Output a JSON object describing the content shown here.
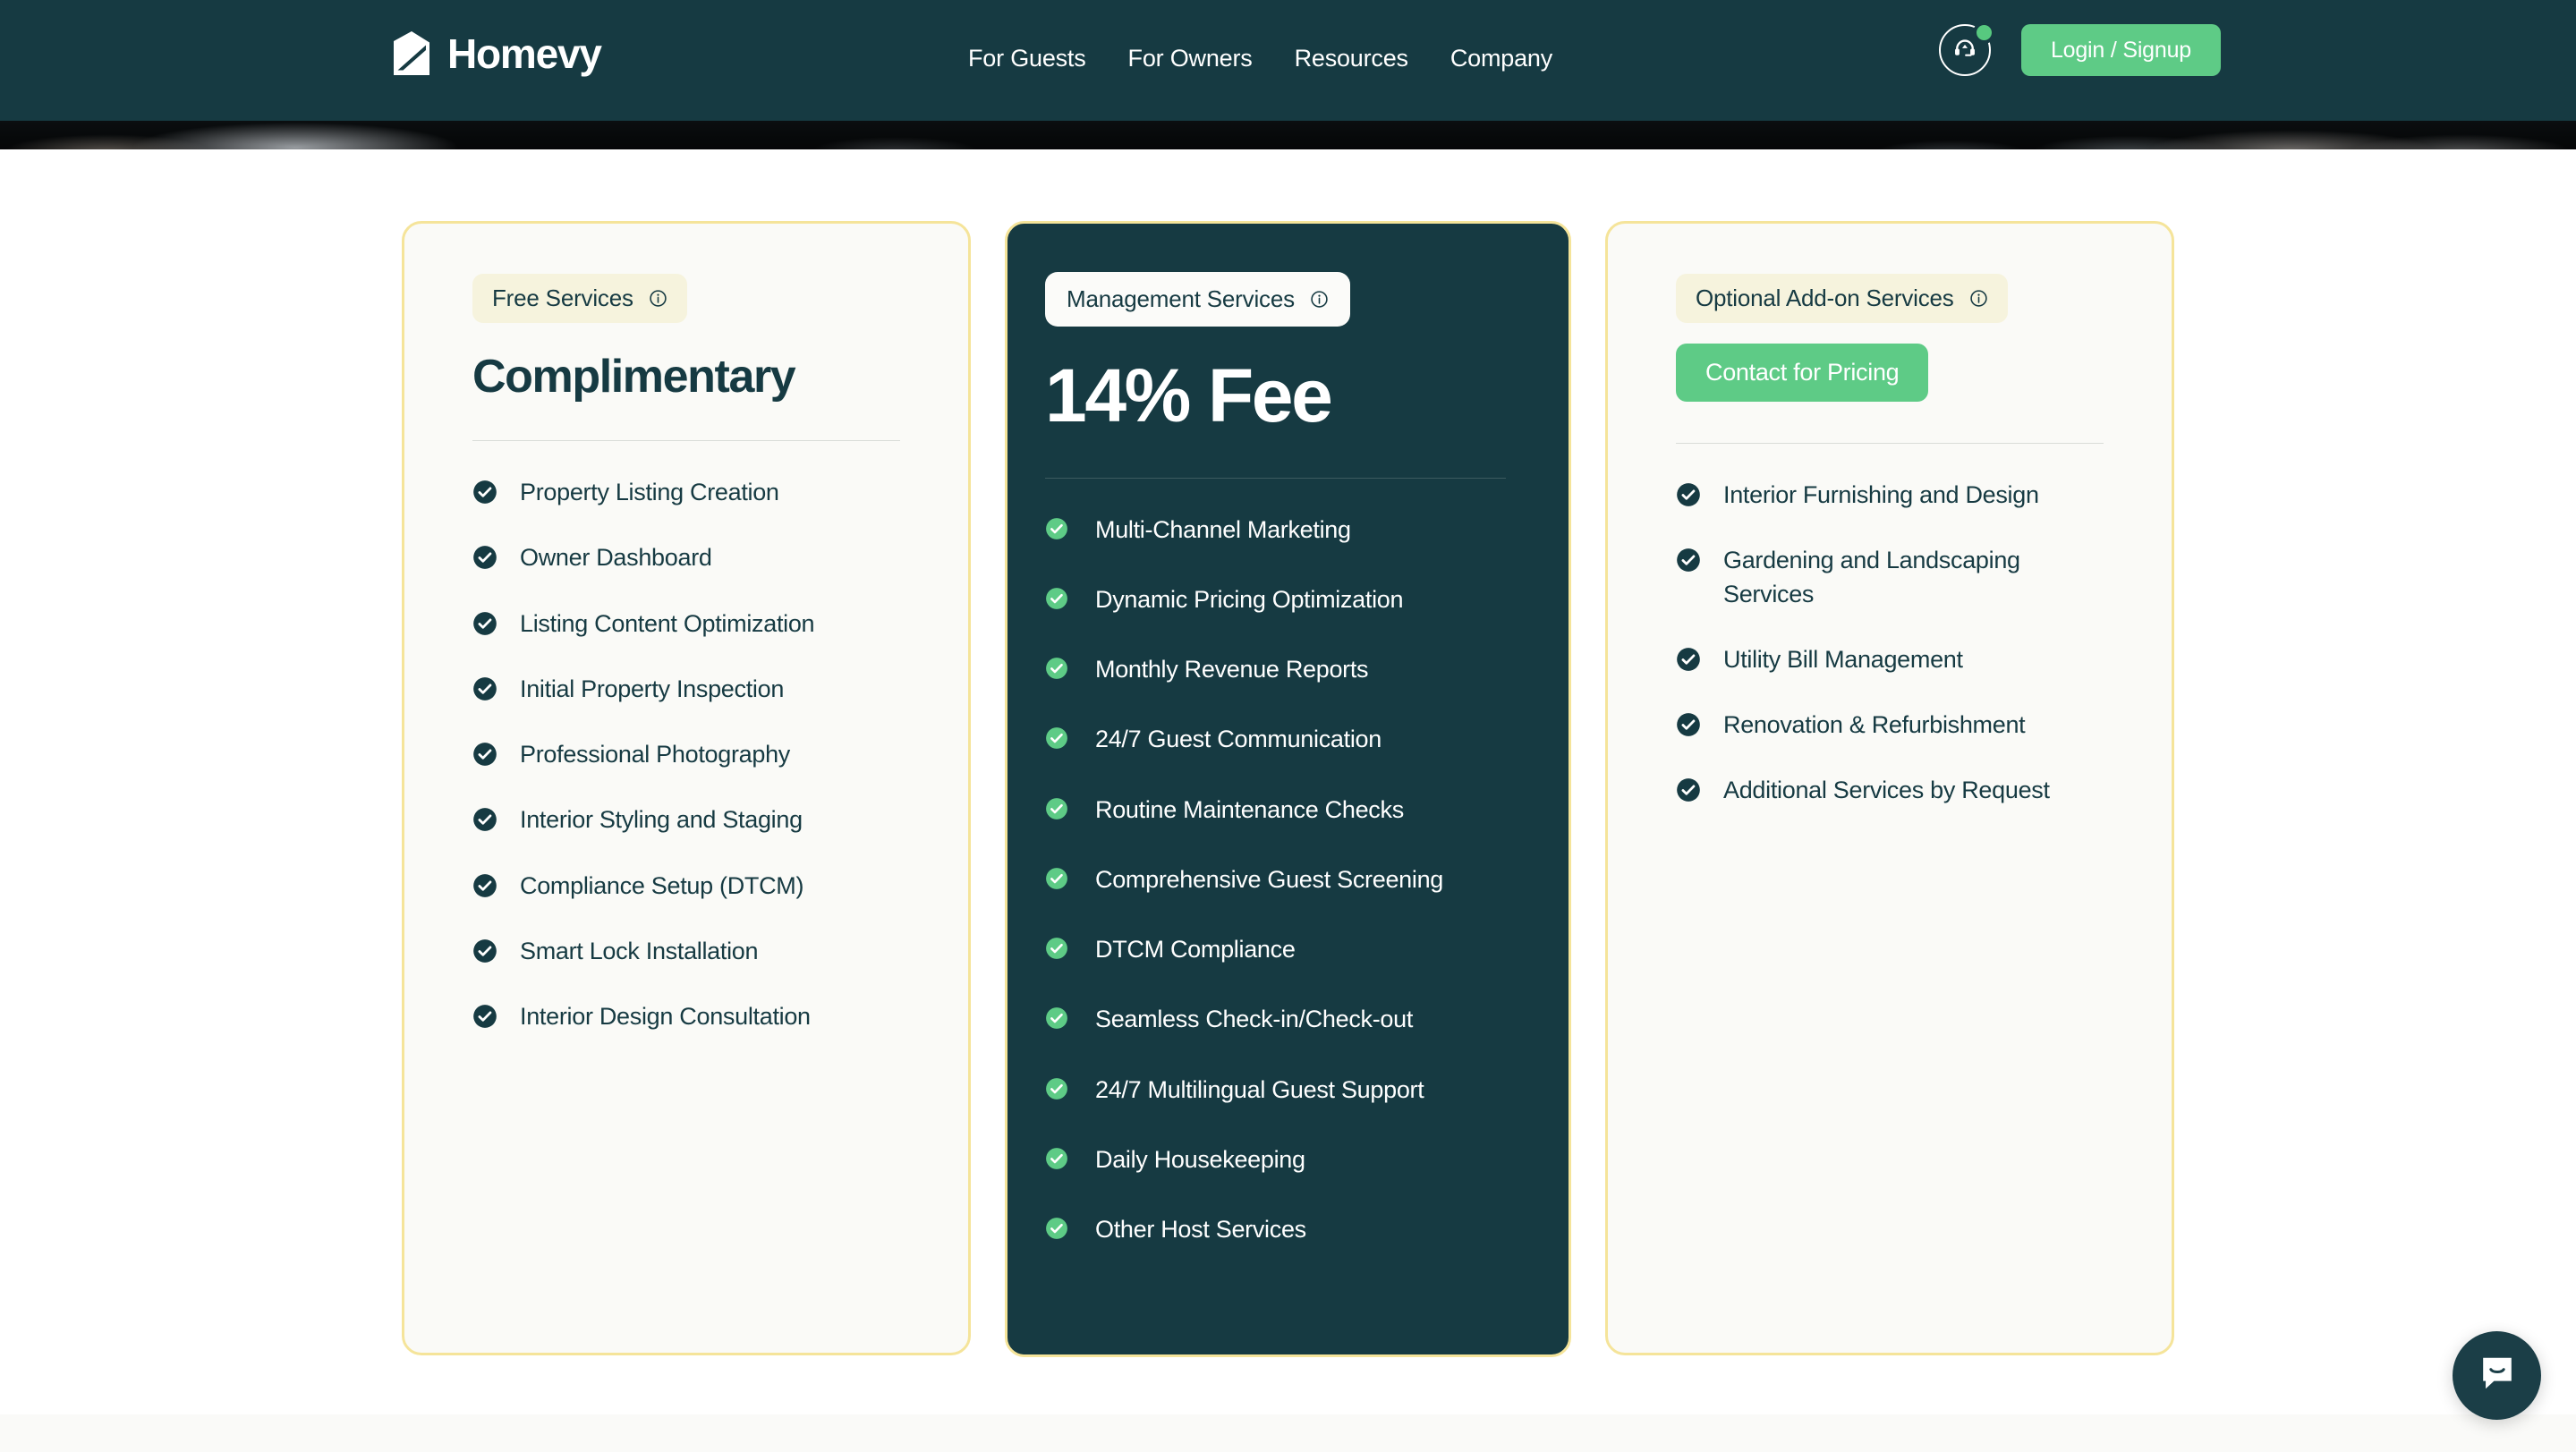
{
  "header": {
    "brand_name": "Homevy",
    "logo_icon": "house-logo-icon",
    "nav": [
      {
        "label": "For Guests"
      },
      {
        "label": "For Owners"
      },
      {
        "label": "Resources"
      },
      {
        "label": "Company"
      }
    ],
    "support_icon": "headset-support-icon",
    "support_status_dot": "online-status-dot",
    "login_label": "Login / Signup",
    "colors": {
      "header_bg": "#163a42",
      "accent_green": "#5ecb86",
      "status_dot": "#57c97f"
    }
  },
  "pricing": {
    "cards": [
      {
        "id": "free-services",
        "tag_label": "Free Services",
        "tag_info_icon": "info-circle-icon",
        "headline": "Complimentary",
        "cta_label": null,
        "features": [
          "Property Listing Creation",
          "Owner Dashboard",
          "Listing Content Optimization",
          "Initial Property Inspection",
          "Professional Photography",
          "Interior Styling and Staging",
          "Compliance Setup (DTCM)",
          "Smart Lock Installation",
          "Interior Design Consultation"
        ]
      },
      {
        "id": "management-services",
        "tag_label": "Management Services",
        "tag_info_icon": "info-circle-icon",
        "headline": "14% Fee",
        "cta_label": null,
        "features": [
          "Multi-Channel Marketing",
          "Dynamic Pricing Optimization",
          "Monthly Revenue Reports",
          "24/7 Guest Communication",
          "Routine Maintenance Checks",
          "Comprehensive Guest Screening",
          "DTCM Compliance",
          "Seamless Check-in/Check-out",
          "24/7 Multilingual Guest Support",
          "Daily Housekeeping",
          "Other Host Services"
        ]
      },
      {
        "id": "optional-addons",
        "tag_label": "Optional Add-on Services",
        "tag_info_icon": "info-circle-icon",
        "headline": null,
        "cta_label": "Contact for Pricing",
        "features": [
          "Interior Furnishing and Design",
          "Gardening and Landscaping Services",
          "Utility Bill Management",
          "Renovation & Refurbishment",
          "Additional Services by Request"
        ]
      }
    ],
    "colors": {
      "card_border": "#f5e49a",
      "card_light_bg": "#fafaf7",
      "card_dark_bg": "#163a42",
      "tag_cream_bg": "#f6f3dd",
      "tag_white_bg": "#fbfbf9",
      "check_dark": "#163a42",
      "check_green": "#5ecb86"
    }
  },
  "chat_widget": {
    "icon": "intercom-chat-smile-icon",
    "bg": "#1b3e47"
  }
}
